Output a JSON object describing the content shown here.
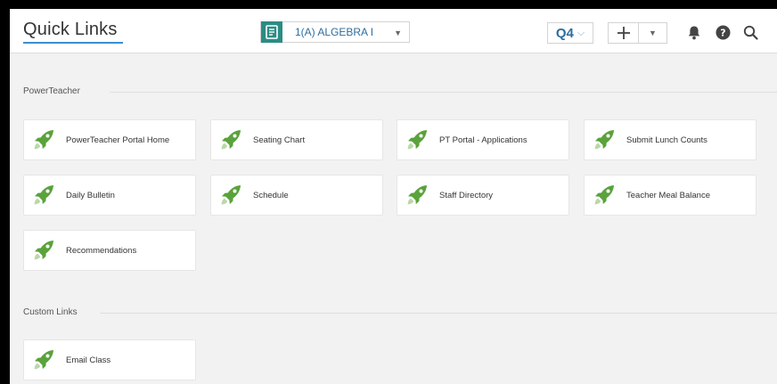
{
  "header": {
    "title": "Quick Links",
    "class_select": {
      "label": "1(A) ALGEBRA I"
    },
    "term_select": {
      "label": "Q4"
    }
  },
  "sections": [
    {
      "title": "PowerTeacher",
      "links": [
        "PowerTeacher Portal Home",
        "Seating Chart",
        "PT Portal - Applications",
        "Submit Lunch Counts",
        "Daily Bulletin",
        "Schedule",
        "Staff Directory",
        "Teacher Meal Balance",
        "Recommendations"
      ]
    },
    {
      "title": "Custom Links",
      "links": [
        "Email Class"
      ]
    }
  ],
  "icons": {
    "rocket": "rocket-icon",
    "bell": "bell-icon",
    "help": "help-icon",
    "search": "search-icon"
  },
  "colors": {
    "accent_blue": "#2c6e9f",
    "class_icon_teal": "#2c8c84",
    "rocket_green": "#5aa23c"
  }
}
